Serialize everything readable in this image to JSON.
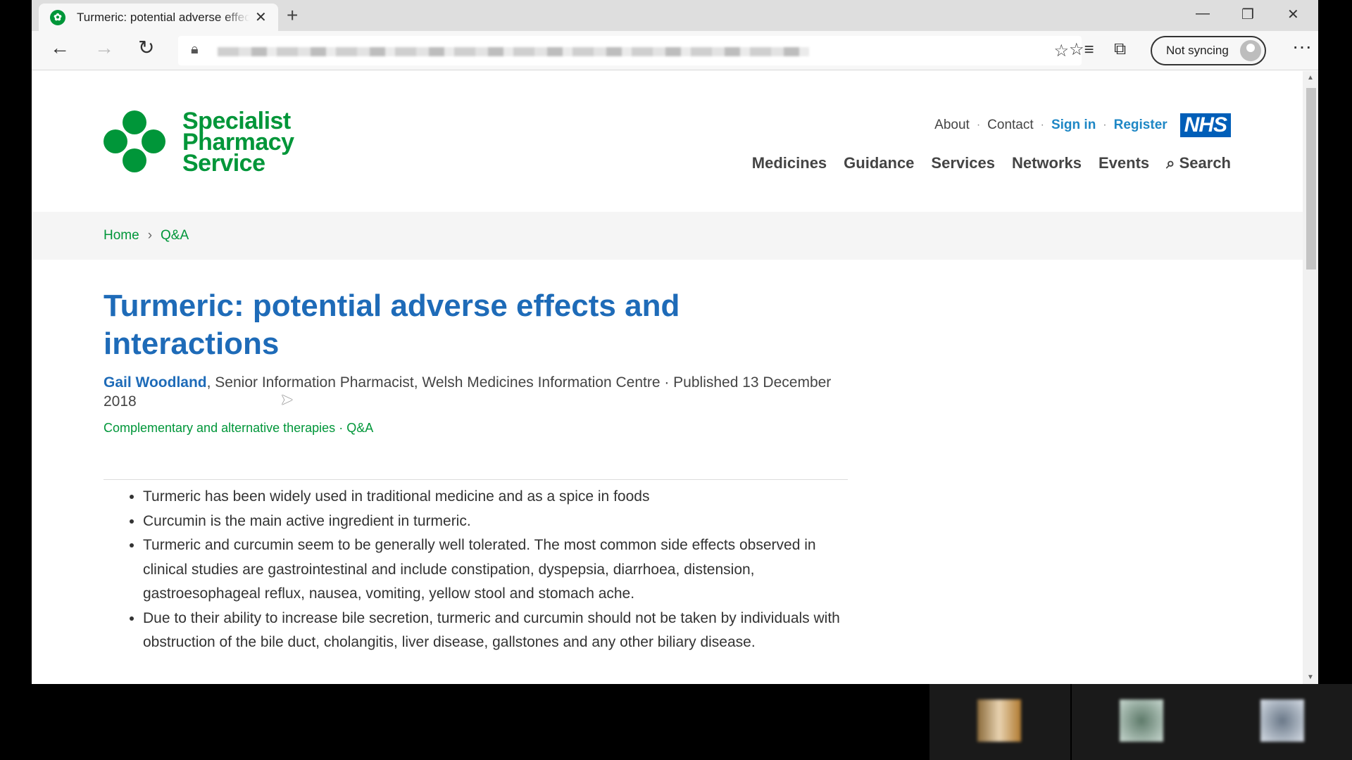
{
  "browser": {
    "tab_title": "Turmeric: potential adverse effects and interactions",
    "tab_close": "✕",
    "new_tab": "+",
    "sync_label": "Not syncing",
    "more": "···"
  },
  "site": {
    "logo_line1": "Specialist",
    "logo_line2": "Pharmacy",
    "logo_line3": "Service",
    "util_nav": {
      "about": "About",
      "contact": "Contact",
      "sign_in": "Sign in",
      "register": "Register",
      "nhs": "NHS",
      "sep": "·"
    },
    "main_nav": {
      "medicines": "Medicines",
      "guidance": "Guidance",
      "services": "Services",
      "networks": "Networks",
      "events": "Events",
      "search": "Search"
    },
    "breadcrumb": {
      "home": "Home",
      "sep": "›",
      "current": "Q&A"
    }
  },
  "article": {
    "title": "Turmeric: potential adverse effects and interactions",
    "author": "Gail Woodland",
    "byline_rest": ", Senior Information Pharmacist, Welsh Medicines Information Centre · Published 13 December 2018",
    "tag1": "Complementary and alternative therapies",
    "tag_sep": " · ",
    "tag2": "Q&A",
    "bullets": [
      "Turmeric has been widely used in traditional medicine and as a spice in foods",
      "Curcumin is the main active ingredient in turmeric.",
      "Turmeric and curcumin seem to be generally well tolerated. The most common side effects observed in clinical studies are gastrointestinal and include constipation, dyspepsia, diarrhoea, distension, gastroesophageal reflux, nausea, vomiting, yellow stool and stomach ache.",
      "Due to their ability to increase bile secretion, turmeric and curcumin should not be taken by individuals with obstruction of the bile duct, cholangitis, liver disease, gallstones and any other biliary disease."
    ]
  },
  "colors": {
    "brand_green": "#009639",
    "title_blue": "#1e6bb8",
    "nhs_blue": "#005eb8"
  }
}
